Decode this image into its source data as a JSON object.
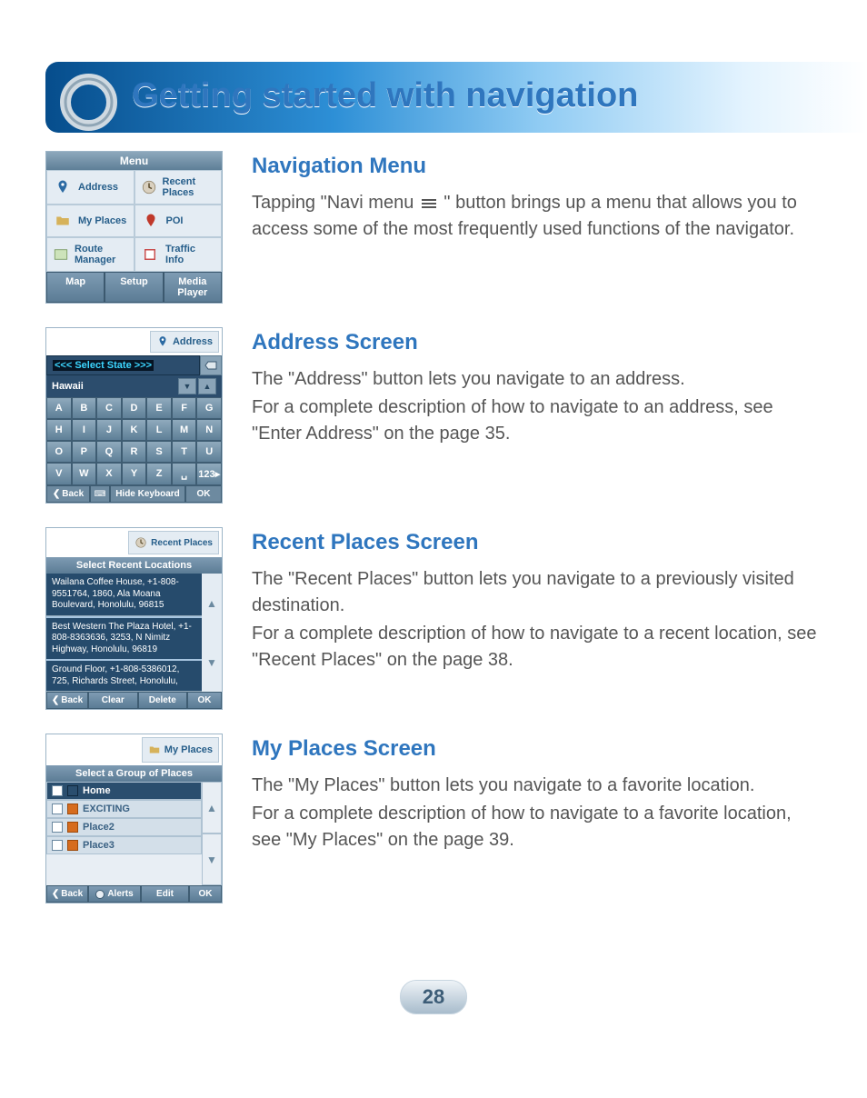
{
  "page_title": "Getting started with navigation",
  "page_number": "28",
  "menu_shot": {
    "title": "Menu",
    "items": [
      "Address",
      "Recent Places",
      "My Places",
      "POI",
      "Route Manager",
      "Traffic Info"
    ],
    "footer": [
      "Map",
      "Setup",
      "Media Player"
    ]
  },
  "nav_menu_section": {
    "heading": "Navigation Menu",
    "p1a": "Tapping \"Navi menu ",
    "p1b": " \" button brings up a menu that allows you to access some of the most frequently used functions of the navigator."
  },
  "address_shot": {
    "chip": "Address",
    "select_state": "<<< Select State >>>",
    "state": "Hawaii",
    "keys": [
      "A",
      "B",
      "C",
      "D",
      "E",
      "F",
      "G",
      "H",
      "I",
      "J",
      "K",
      "L",
      "M",
      "N",
      "O",
      "P",
      "Q",
      "R",
      "S",
      "T",
      "U",
      "V",
      "W",
      "X",
      "Y",
      "Z",
      "␣",
      "123▸"
    ],
    "back": "Back",
    "hide": "Hide Keyboard",
    "ok": "OK"
  },
  "address_section": {
    "heading": "Address Screen",
    "p1": "The \"Address\" button lets you navigate to an address.",
    "p2": "For a complete description of how to navigate to an address, see \"Enter Address\" on the page 35."
  },
  "recent_shot": {
    "chip": "Recent Places",
    "title": "Select Recent Locations",
    "items": [
      "Wailana Coffee House, +1-808-9551764, 1860, Ala Moana Boulevard, Honolulu, 96815",
      "Best Western The Plaza Hotel, +1-808-8363636, 3253, N Nimitz Highway, Honolulu, 96819",
      "Ground Floor, +1-808-5386012, 725, Richards Street, Honolulu,"
    ],
    "back": "Back",
    "clear": "Clear",
    "delete": "Delete",
    "ok": "OK"
  },
  "recent_section": {
    "heading": "Recent Places Screen",
    "p1": "The \"Recent Places\" button lets you navigate to a previously visited destination.",
    "p2": "For a complete description of how to navigate to a recent location, see \"Recent Places\" on the page 38."
  },
  "myp_shot": {
    "chip": "My Places",
    "title": "Select a Group of Places",
    "items": [
      "Home",
      "EXCITING",
      "Place2",
      "Place3"
    ],
    "back": "Back",
    "alerts": "Alerts",
    "edit": "Edit",
    "ok": "OK"
  },
  "myp_section": {
    "heading": "My Places Screen",
    "p1": "The \"My Places\" button lets you navigate to a favorite location.",
    "p2": "For a complete description of how to navigate to a favorite location, see \"My Places\" on the page 39."
  }
}
